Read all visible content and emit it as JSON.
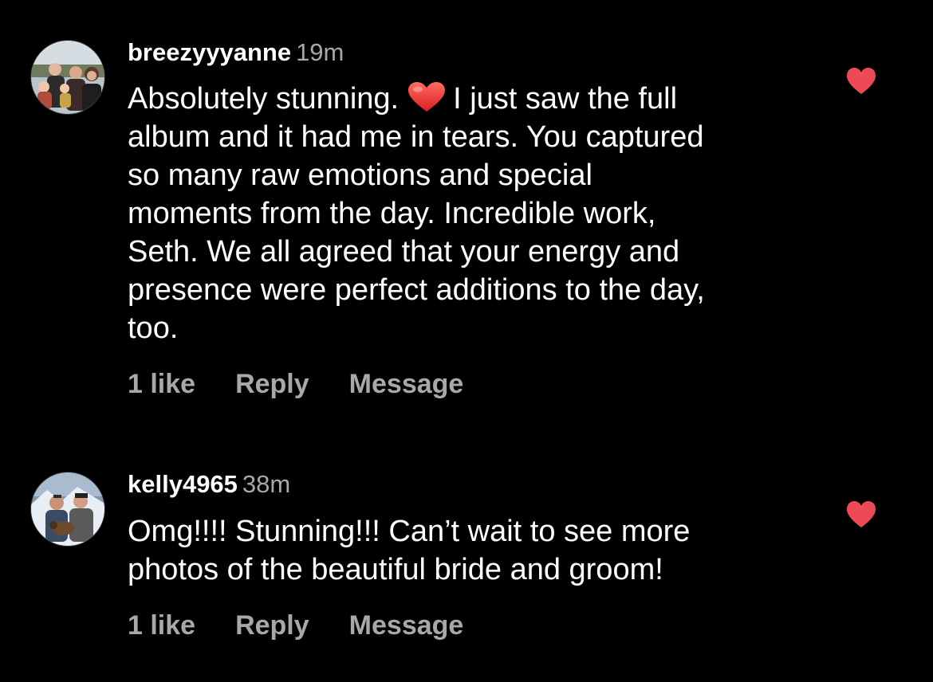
{
  "comments": [
    {
      "username": "breezyyyanne",
      "time": "19m",
      "text_before_emoji": "Absolutely stunning.",
      "emoji": "red-heart-emoji",
      "text_after_emoji": "I just saw the full",
      "lines": [
        "album and it had me in tears. You captured",
        "so many raw emotions and special",
        "moments from the day. Incredible work,",
        "Seth. We all agreed that your energy and",
        "presence were perfect additions to the day,",
        "too."
      ],
      "likes": "1 like",
      "reply_label": "Reply",
      "message_label": "Message",
      "liked": true
    },
    {
      "username": "kelly4965",
      "time": "38m",
      "lines": [
        "Omg!!!! Stunning!!! Can’t wait to see more",
        "photos of the beautiful bride and groom!"
      ],
      "likes": "1 like",
      "reply_label": "Reply",
      "message_label": "Message",
      "liked": true
    }
  ],
  "colors": {
    "background": "#000000",
    "primary_text": "#ffffff",
    "secondary_text": "#a8a8a8",
    "heart": "#ed4956"
  },
  "icons": {
    "like": "heart-filled-icon"
  }
}
